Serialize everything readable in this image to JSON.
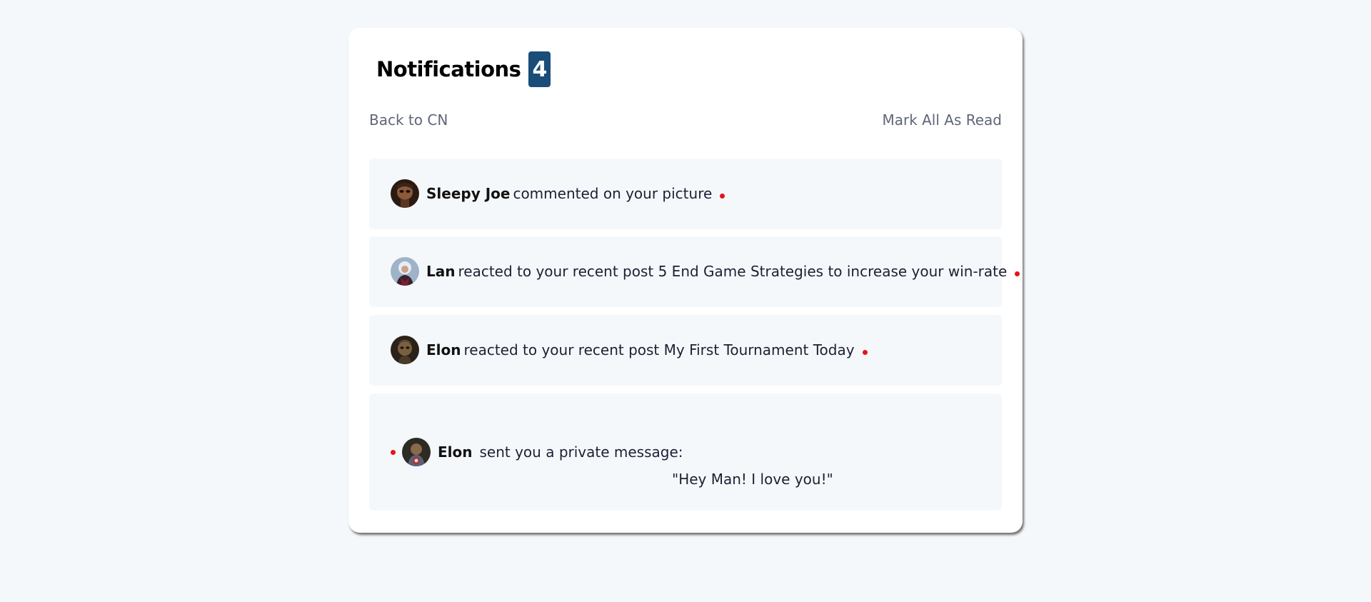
{
  "header": {
    "title": "Notifications",
    "unread_count": "4"
  },
  "links": {
    "back": "Back to CN",
    "mark_all": "Mark All As Read"
  },
  "notifications": [
    {
      "name": "Sleepy Joe",
      "text": "commented on your picture",
      "unread": true
    },
    {
      "name": "Lan",
      "text": "reacted to your recent post 5 End Game Strategies to increase your win-rate",
      "unread": true
    },
    {
      "name": "Elon",
      "text": "reacted to your recent post My First Tournament Today",
      "unread": true
    },
    {
      "name": "Elon",
      "text": "sent you a private message:",
      "message": "\"Hey Man! I love you!\"",
      "unread": true
    }
  ],
  "colors": {
    "background": "#f5f8fb",
    "card": "#ffffff",
    "badge": "#1a4d78",
    "unread_dot": "#e6131a",
    "link_text": "#5f6678"
  }
}
